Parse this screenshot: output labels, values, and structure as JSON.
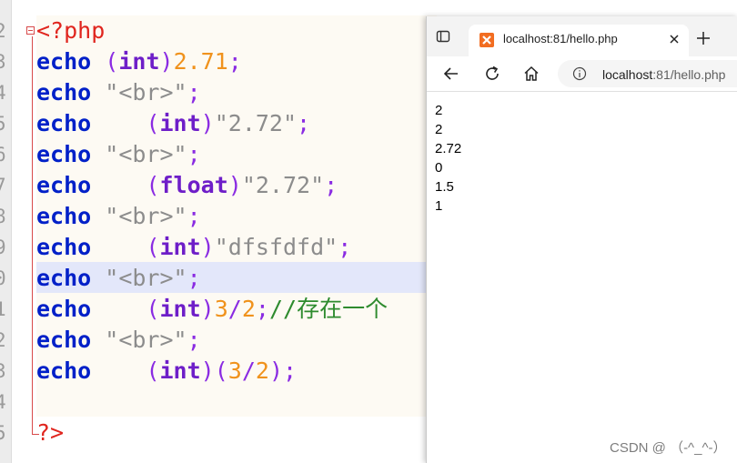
{
  "editor": {
    "line_numbers": [
      "2",
      "3",
      "4",
      "5",
      "6",
      "7",
      "8",
      "9",
      "0",
      "1",
      "2",
      "3",
      "4",
      "5"
    ],
    "lines": [
      {
        "tokens": [
          {
            "t": "tag",
            "v": "<?php"
          }
        ]
      },
      {
        "tokens": [
          {
            "t": "kw",
            "v": "echo"
          },
          {
            "t": "sp",
            "v": " "
          },
          {
            "t": "pu",
            "v": "("
          },
          {
            "t": "ty",
            "v": "int"
          },
          {
            "t": "pu",
            "v": ")"
          },
          {
            "t": "num",
            "v": "2.71"
          },
          {
            "t": "pu",
            "v": ";"
          }
        ]
      },
      {
        "tokens": [
          {
            "t": "kw",
            "v": "echo"
          },
          {
            "t": "sp",
            "v": " "
          },
          {
            "t": "str",
            "v": "\"<br>\""
          },
          {
            "t": "pu",
            "v": ";"
          }
        ]
      },
      {
        "tokens": [
          {
            "t": "kw",
            "v": "echo"
          },
          {
            "t": "sp",
            "v": "    "
          },
          {
            "t": "pu",
            "v": "("
          },
          {
            "t": "ty",
            "v": "int"
          },
          {
            "t": "pu",
            "v": ")"
          },
          {
            "t": "str",
            "v": "\"2.72\""
          },
          {
            "t": "pu",
            "v": ";"
          }
        ]
      },
      {
        "tokens": [
          {
            "t": "kw",
            "v": "echo"
          },
          {
            "t": "sp",
            "v": " "
          },
          {
            "t": "str",
            "v": "\"<br>\""
          },
          {
            "t": "pu",
            "v": ";"
          }
        ]
      },
      {
        "tokens": [
          {
            "t": "kw",
            "v": "echo"
          },
          {
            "t": "sp",
            "v": "    "
          },
          {
            "t": "pu",
            "v": "("
          },
          {
            "t": "ty",
            "v": "float"
          },
          {
            "t": "pu",
            "v": ")"
          },
          {
            "t": "str",
            "v": "\"2.72\""
          },
          {
            "t": "pu",
            "v": ";"
          }
        ]
      },
      {
        "tokens": [
          {
            "t": "kw",
            "v": "echo"
          },
          {
            "t": "sp",
            "v": " "
          },
          {
            "t": "str",
            "v": "\"<br>\""
          },
          {
            "t": "pu",
            "v": ";"
          }
        ]
      },
      {
        "tokens": [
          {
            "t": "kw",
            "v": "echo"
          },
          {
            "t": "sp",
            "v": "    "
          },
          {
            "t": "pu",
            "v": "("
          },
          {
            "t": "ty",
            "v": "int"
          },
          {
            "t": "pu",
            "v": ")"
          },
          {
            "t": "str",
            "v": "\"dfsfdfd\""
          },
          {
            "t": "pu",
            "v": ";"
          }
        ]
      },
      {
        "tokens": [
          {
            "t": "kw",
            "v": "echo"
          },
          {
            "t": "sp",
            "v": " "
          },
          {
            "t": "str",
            "v": "\"<br>\""
          },
          {
            "t": "pu",
            "v": ";"
          }
        ]
      },
      {
        "tokens": [
          {
            "t": "kw",
            "v": "echo"
          },
          {
            "t": "sp",
            "v": "    "
          },
          {
            "t": "pu",
            "v": "("
          },
          {
            "t": "ty",
            "v": "int"
          },
          {
            "t": "pu",
            "v": ")"
          },
          {
            "t": "num",
            "v": "3"
          },
          {
            "t": "pu",
            "v": "/"
          },
          {
            "t": "num",
            "v": "2"
          },
          {
            "t": "pu",
            "v": ";"
          },
          {
            "t": "cm",
            "v": "//存在一个"
          }
        ]
      },
      {
        "tokens": [
          {
            "t": "kw",
            "v": "echo"
          },
          {
            "t": "sp",
            "v": " "
          },
          {
            "t": "str",
            "v": "\"<br>\""
          },
          {
            "t": "pu",
            "v": ";"
          }
        ]
      },
      {
        "tokens": [
          {
            "t": "kw",
            "v": "echo"
          },
          {
            "t": "sp",
            "v": "    "
          },
          {
            "t": "pu",
            "v": "("
          },
          {
            "t": "ty",
            "v": "int"
          },
          {
            "t": "pu",
            "v": ")("
          },
          {
            "t": "num",
            "v": "3"
          },
          {
            "t": "pu",
            "v": "/"
          },
          {
            "t": "num",
            "v": "2"
          },
          {
            "t": "pu",
            "v": ");"
          }
        ]
      },
      {
        "tokens": []
      },
      {
        "tokens": [
          {
            "t": "tag",
            "v": "?>"
          }
        ]
      }
    ]
  },
  "browser": {
    "tab_title": "localhost:81/hello.php",
    "url_host": "localhost",
    "url_path": ":81/hello.php",
    "output": [
      "2",
      "2",
      "2.72",
      "0",
      "1.5",
      "1"
    ]
  },
  "watermark": "CSDN @ （-^_^-）",
  "colors": {
    "accent": "#f26d21",
    "highlight": "#e3e7fa",
    "keyword": "#0020c8"
  },
  "icons": [
    "tab-actions-icon",
    "xampp-favicon-icon",
    "close-icon",
    "plus-icon",
    "back-arrow-icon",
    "reload-icon",
    "home-icon",
    "info-icon"
  ]
}
